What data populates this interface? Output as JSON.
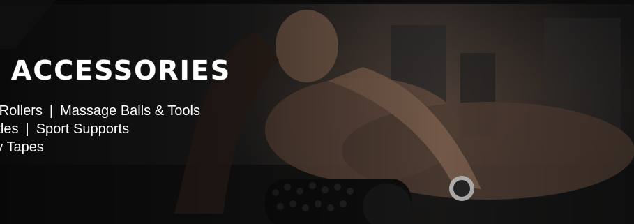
{
  "banner": {
    "headline": "RY ACCESSORIES",
    "lines": [
      [
        "Foam Rollers",
        "Massage Balls & Tools"
      ],
      [
        "er Bottles",
        "Sport Supports"
      ],
      [
        "siology Tapes"
      ]
    ],
    "separator": "|"
  },
  "colors": {
    "text": "#ffffff",
    "background_dark": "#141414",
    "skin_tone": "#7b5e4e"
  }
}
